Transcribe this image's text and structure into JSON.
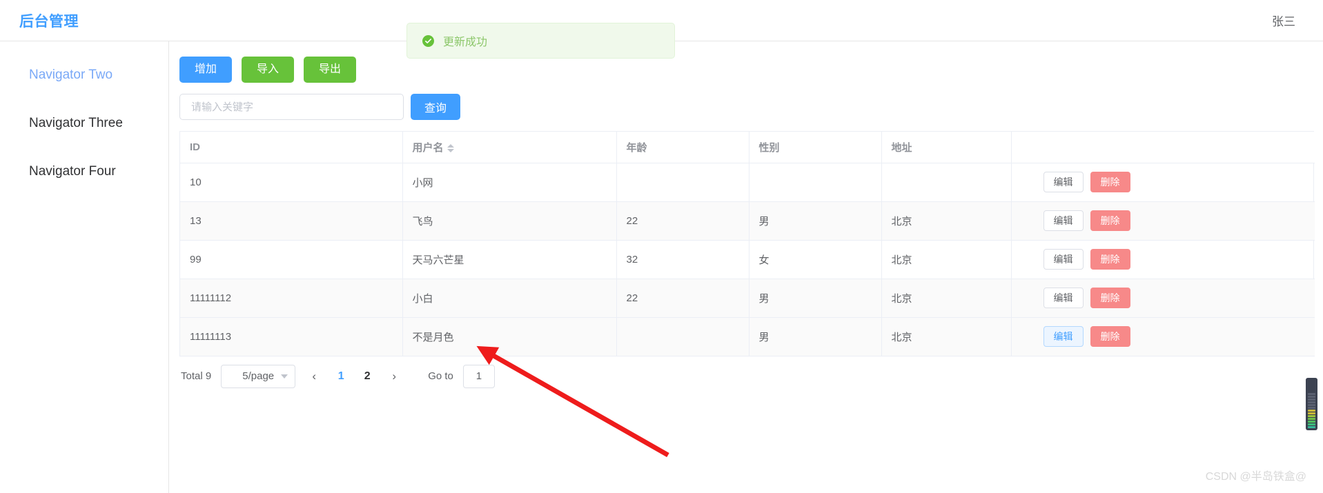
{
  "header": {
    "brand": "后台管理",
    "user": "张三"
  },
  "sidebar": {
    "items": [
      {
        "label": "Navigator Two",
        "active": true
      },
      {
        "label": "Navigator Three",
        "active": false
      },
      {
        "label": "Navigator Four",
        "active": false
      }
    ]
  },
  "toolbar": {
    "add_label": "增加",
    "import_label": "导入",
    "export_label": "导出"
  },
  "search": {
    "placeholder": "请输入关键字",
    "value": "",
    "query_label": "查询"
  },
  "table": {
    "columns": [
      "ID",
      "用户名",
      "年龄",
      "性别",
      "地址",
      ""
    ],
    "sortable_column": "用户名",
    "rows": [
      {
        "id": "10",
        "name": "小网",
        "age": "",
        "gender": "",
        "address": "",
        "edit": "编辑",
        "delete": "删除",
        "edit_focused": false
      },
      {
        "id": "13",
        "name": "飞鸟",
        "age": "22",
        "gender": "男",
        "address": "北京",
        "edit": "编辑",
        "delete": "删除",
        "edit_focused": false
      },
      {
        "id": "99",
        "name": "天马六芒星",
        "age": "32",
        "gender": "女",
        "address": "北京",
        "edit": "编辑",
        "delete": "删除",
        "edit_focused": false
      },
      {
        "id": "11111112",
        "name": "小白",
        "age": "22",
        "gender": "男",
        "address": "北京",
        "edit": "编辑",
        "delete": "删除",
        "edit_focused": false
      },
      {
        "id": "11111113",
        "name": "不是月色",
        "age": "",
        "gender": "男",
        "address": "北京",
        "edit": "编辑",
        "delete": "删除",
        "edit_focused": true
      }
    ]
  },
  "pagination": {
    "total_label": "Total 9",
    "page_size_label": "5/page",
    "prev_icon": "chevron-left",
    "next_icon": "chevron-right",
    "pages": [
      "1",
      "2"
    ],
    "current_page": "1",
    "goto_label": "Go to",
    "goto_value": "1"
  },
  "toast": {
    "message": "更新成功",
    "icon": "check-circle-icon",
    "color": "#67C23A",
    "background": "#f0f9eb"
  },
  "annotation": {
    "arrow_color": "#ee1c1c"
  },
  "watermark": {
    "text": "CSDN @半岛铁盒@"
  },
  "colors": {
    "primary": "#409EFF",
    "success": "#67C23A",
    "danger": "#f78989",
    "text": "#606266"
  }
}
